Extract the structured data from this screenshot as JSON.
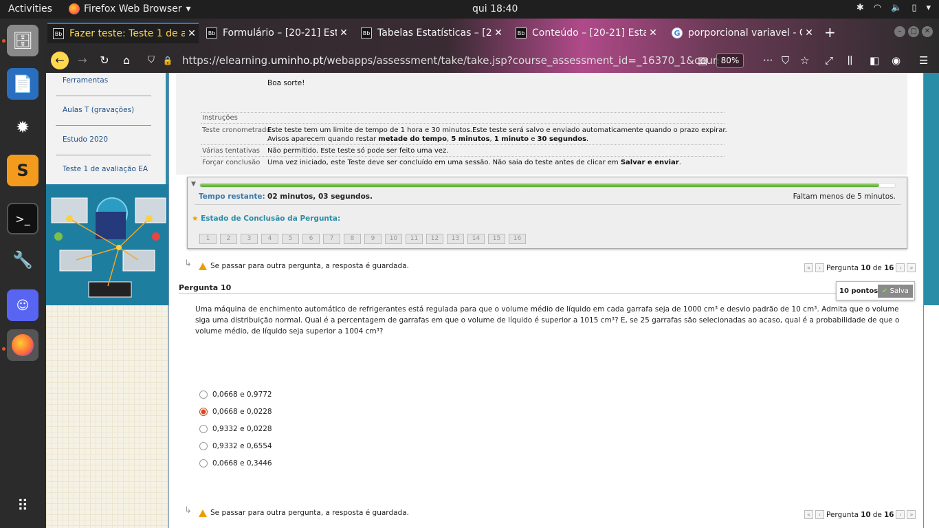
{
  "system": {
    "activities": "Activities",
    "app_name": "Firefox Web Browser",
    "clock": "qui 18:40"
  },
  "tabs": [
    {
      "title": "Fazer teste: Teste 1 de av",
      "favicon": "Bb"
    },
    {
      "title": "Formulário – [20-21] Esta",
      "favicon": "Bb"
    },
    {
      "title": "Tabelas Estatísticas – [20",
      "favicon": "Bb"
    },
    {
      "title": "Conteúdo – [20-21] Estat",
      "favicon": "Bb"
    },
    {
      "title": "porporcional variavel - G",
      "favicon": "G"
    }
  ],
  "url": {
    "prefix": "https://elearning.",
    "domain": "uminho.pt",
    "path": "/webapps/assessment/take/take.jsp?course_assessment_id=_16370_1&course"
  },
  "zoom": "80%",
  "leftnav": [
    "Ferramentas",
    "Aulas T (gravações)",
    "Estudo 2020",
    "Teste 1 de avaliação EA"
  ],
  "instructions": {
    "good_luck": "Boa sorte!",
    "heading": "Instruções",
    "timed_label": "Teste cronometrado",
    "timed_line1": "Este teste tem um limite de tempo de 1 hora e 30 minutos.Este teste será salvo e enviado automaticamente quando o prazo expirar.",
    "timed_line2_a": "Avisos aparecem quando restar ",
    "timed_line2_b": "metade do tempo",
    "timed_line2_c": ", ",
    "timed_line2_d": "5 minutos",
    "timed_line2_e": ", ",
    "timed_line2_f": "1 minuto",
    "timed_line2_g": " e ",
    "timed_line2_h": "30 segundos",
    "timed_line2_i": ".",
    "attempts_label": "Várias tentativas",
    "attempts_value": "Não permitido. Este teste só pode ser feito uma vez.",
    "force_label": "Forçar conclusão",
    "force_value_a": "Uma vez iniciado, este Teste deve ser concluído em uma sessão. Não saia do teste antes de clicar em ",
    "force_value_b": "Salvar e enviar",
    "force_value_c": "."
  },
  "timer": {
    "label": "Tempo restante:",
    "minutes": "02",
    "minutes_word": " minutos, ",
    "seconds": "03",
    "seconds_word": " segundos.",
    "warning": "Faltam menos de 5 minutos.",
    "progress_fraction": 0.977,
    "status_title": "Estado de Conclusão da Pergunta:",
    "question_numbers": [
      "1",
      "2",
      "3",
      "4",
      "5",
      "6",
      "7",
      "8",
      "9",
      "10",
      "11",
      "12",
      "13",
      "14",
      "15",
      "16"
    ]
  },
  "nav": {
    "warning": "Se passar para outra pergunta, a resposta é guardada.",
    "pergunta": "Pergunta",
    "current": "10",
    "de": "de",
    "total": "16"
  },
  "question": {
    "title": "Pergunta 10",
    "points": "10 pontos",
    "saved": "Salva",
    "text": "Uma máquina de enchimento automático de refrigerantes está regulada para que o volume médio de líquido em cada garrafa seja de 1000 cm³ e desvio padrão de 10 cm³. Admita que o volume siga uma distribuição normal. Qual é a percentagem de garrafas em que o volume de líquido é superior a 1015 cm³? E, se 25 garrafas são selecionadas ao acaso, qual é a probabilidade de que o volume  médio, de líquido seja superior a 1004 cm³?",
    "options": [
      {
        "label": "0,0668 e 0,9772",
        "selected": false
      },
      {
        "label": "0,0668 e 0,0228",
        "selected": true
      },
      {
        "label": "0,9332 e 0,0228",
        "selected": false
      },
      {
        "label": "0,9332 e 0,6554",
        "selected": false
      },
      {
        "label": "0,0668 e 0,3446",
        "selected": false
      }
    ]
  },
  "colors": {
    "accent": "#0a84ff",
    "progress": "#5aa83a",
    "selected_radio": "#d9471c",
    "link": "#1d4f8a"
  }
}
